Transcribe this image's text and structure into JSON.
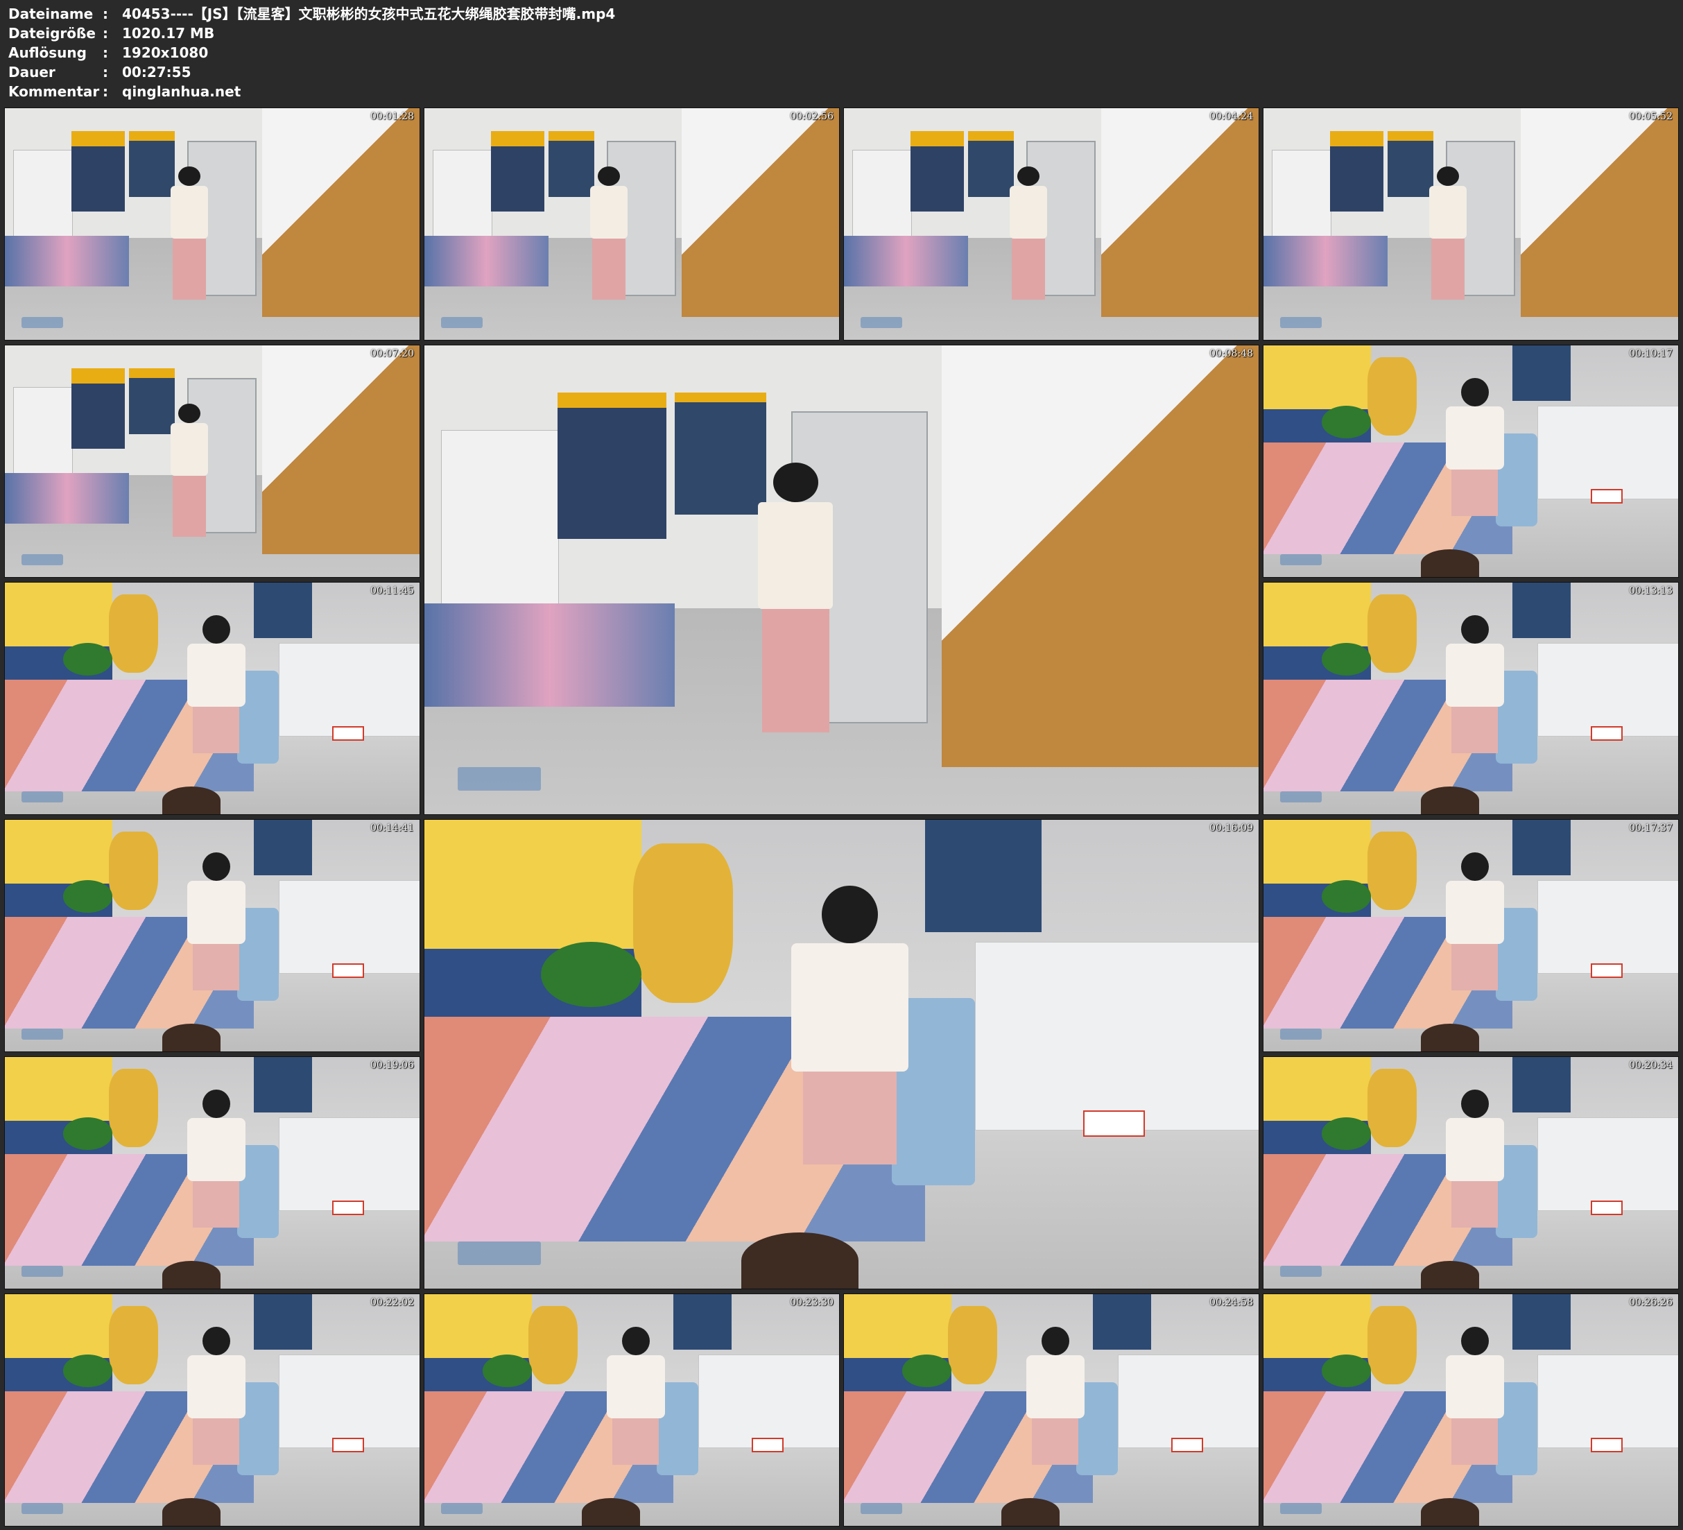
{
  "file_info": [
    {
      "key": "Dateiname",
      "value": "40453----【JS】【流星客】文职彬彬的女孩中式五花大绑绳胶套胶带封嘴.mp4"
    },
    {
      "key": "Dateigröße",
      "value": "1020.17 MB"
    },
    {
      "key": "Auflösung",
      "value": "1920x1080"
    },
    {
      "key": "Dauer",
      "value": "00:27:55"
    },
    {
      "key": "Kommentar",
      "value": "qinglanhua.net"
    }
  ],
  "separator": ":",
  "thumbnails": [
    {
      "time": "00:01:28",
      "scene": "hallway"
    },
    {
      "time": "00:02:56",
      "scene": "hallway"
    },
    {
      "time": "00:04:24",
      "scene": "hallway"
    },
    {
      "time": "00:05:52",
      "scene": "hallway"
    },
    {
      "time": "00:07:20",
      "scene": "hallway"
    },
    {
      "time": "00:08:48",
      "scene": "hallway"
    },
    {
      "time": "00:10:17",
      "scene": "seated"
    },
    {
      "time": "00:11:45",
      "scene": "seated"
    },
    {
      "time": "00:13:13",
      "scene": "seated"
    },
    {
      "time": "00:14:41",
      "scene": "seated"
    },
    {
      "time": "00:16:09",
      "scene": "seated"
    },
    {
      "time": "00:17:37",
      "scene": "seated"
    },
    {
      "time": "00:19:06",
      "scene": "seated"
    },
    {
      "time": "00:20:34",
      "scene": "seated"
    },
    {
      "time": "00:22:02",
      "scene": "seated"
    },
    {
      "time": "00:23:30",
      "scene": "seated"
    },
    {
      "time": "00:24:58",
      "scene": "seated"
    },
    {
      "time": "00:26:26",
      "scene": "seated"
    }
  ]
}
